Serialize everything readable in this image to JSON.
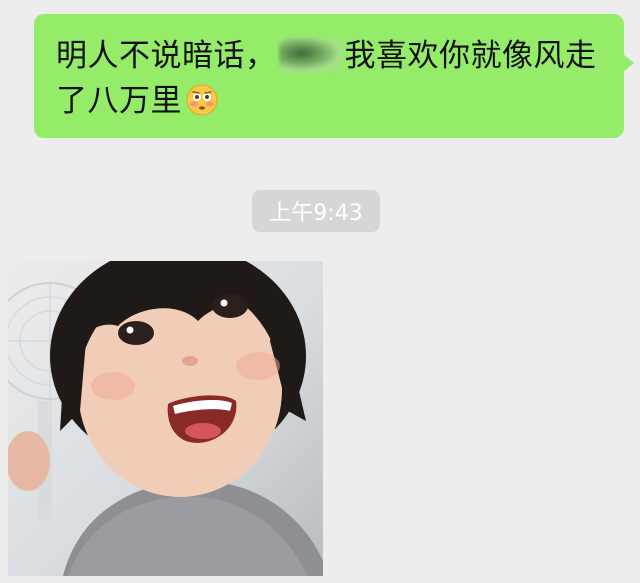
{
  "messages": {
    "outgoing": {
      "text_before": "明人不说暗话，",
      "text_after": "我喜欢你就像风走了八万里",
      "redacted_name": "blurred-name",
      "emoji": "flushed-face-emoji",
      "bubble_color": "#95ec69"
    },
    "timestamp": "上午9:43",
    "incoming_photo": {
      "subject": "smiling-child-photo"
    }
  },
  "colors": {
    "background": "#ededed",
    "bubble_green": "#95ec69",
    "timestamp_bg": "#d6d6d6"
  }
}
